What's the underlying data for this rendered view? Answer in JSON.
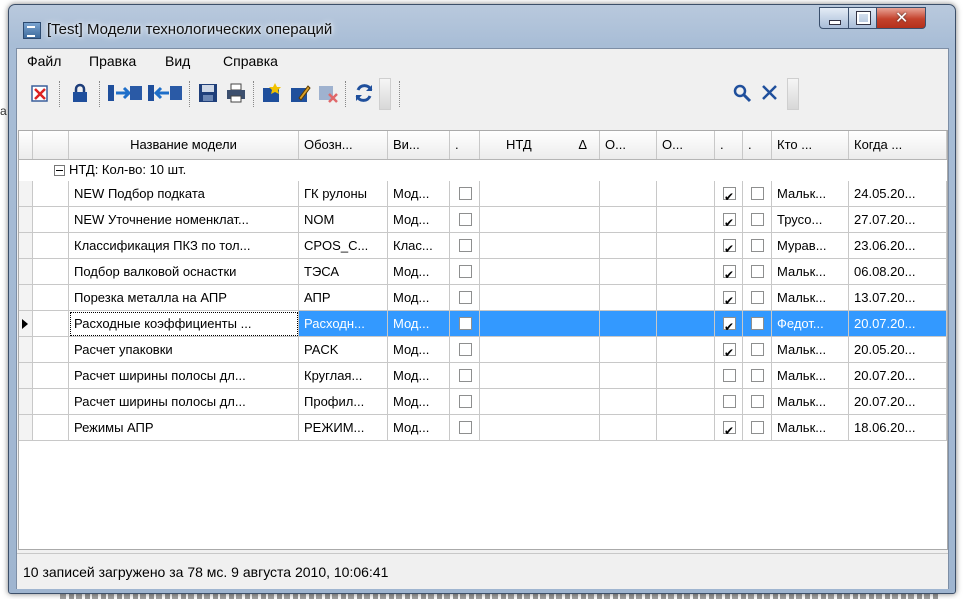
{
  "window": {
    "title": "[Test] Модели технологических операций"
  },
  "background_fragment": "а",
  "menu": [
    "Файл",
    "Правка",
    "Вид",
    "Справка"
  ],
  "toolbar": {
    "buttons": [
      "delete-checkbox-icon",
      "lock-icon",
      "import-icon",
      "export-icon",
      "save-icon",
      "print-icon",
      "new-item-icon",
      "edit-item-icon",
      "remove-item-icon",
      "refresh-icon"
    ],
    "search_icon": "search-icon",
    "clear_icon": "clear-icon"
  },
  "grid": {
    "columns": [
      "Название модели",
      "Обозн...",
      "Ви...",
      ".",
      "НТД",
      "Δ",
      "О...",
      "О...",
      ".",
      ".",
      "Кто ...",
      "Когда ..."
    ],
    "group_label": "НТД:  Кол-во: 10 шт.",
    "rows": [
      {
        "name": "NEW Подбор подката",
        "code": "ГК рулоны",
        "type": "Мод...",
        "c1": false,
        "c2": true,
        "c3": false,
        "who": "Мальк...",
        "when": "24.05.20..."
      },
      {
        "name": "NEW Уточнение номенклат...",
        "code": "NOM",
        "type": "Мод...",
        "c1": false,
        "c2": true,
        "c3": false,
        "who": "Трусо...",
        "when": "27.07.20..."
      },
      {
        "name": "Классификация ПКЗ по тол...",
        "code": "CPOS_C...",
        "type": "Клас...",
        "c1": false,
        "c2": true,
        "c3": false,
        "who": "Мурав...",
        "when": "23.06.20..."
      },
      {
        "name": "Подбор валковой оснастки",
        "code": "ТЭСА",
        "type": "Мод...",
        "c1": false,
        "c2": true,
        "c3": false,
        "who": "Мальк...",
        "when": "06.08.20..."
      },
      {
        "name": "Порезка металла на АПР",
        "code": "АПР",
        "type": "Мод...",
        "c1": false,
        "c2": true,
        "c3": false,
        "who": "Мальк...",
        "when": "13.07.20..."
      },
      {
        "name": "Расходные коэффициенты ...",
        "code": "Расходн...",
        "type": "Мод...",
        "c1": false,
        "c2": true,
        "c3": false,
        "who": "Федот...",
        "when": "20.07.20...",
        "selected": true
      },
      {
        "name": "Расчет упаковки",
        "code": "PACK",
        "type": "Мод...",
        "c1": false,
        "c2": true,
        "c3": false,
        "who": "Мальк...",
        "when": "20.05.20..."
      },
      {
        "name": "Расчет ширины полосы дл...",
        "code": "Круглая...",
        "type": "Мод...",
        "c1": false,
        "c2": false,
        "c3": false,
        "who": "Мальк...",
        "when": "20.07.20..."
      },
      {
        "name": "Расчет ширины полосы дл...",
        "code": "Профил...",
        "type": "Мод...",
        "c1": false,
        "c2": false,
        "c3": false,
        "who": "Мальк...",
        "when": "20.07.20..."
      },
      {
        "name": "Режимы АПР",
        "code": "РЕЖИМ...",
        "type": "Мод...",
        "c1": false,
        "c2": true,
        "c3": false,
        "who": "Мальк...",
        "when": "18.06.20..."
      }
    ]
  },
  "status": {
    "text": "10 записей загружено за 78 мс. 9 августа 2010, 10:06:41"
  },
  "colors": {
    "selection": "#3399ff",
    "close_button": "#c4422c"
  }
}
